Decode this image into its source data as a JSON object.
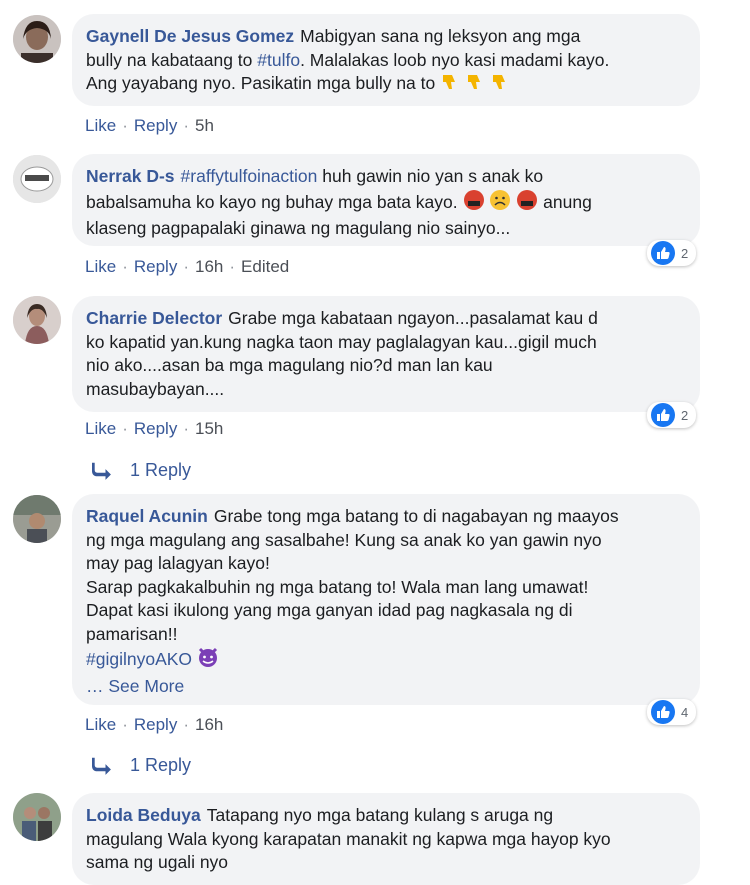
{
  "actions": {
    "like": "Like",
    "reply": "Reply",
    "separator": "·"
  },
  "colors": {
    "link": "#385898",
    "bubble": "#f2f3f5",
    "like_blue": "#1877f2"
  },
  "comments": [
    {
      "author": "Gaynell De Jesus Gomez",
      "lines": [
        [
          "Mabigyan sana ng leksyon ang mga"
        ],
        [
          "bully na kabataang to ",
          "#tulfo",
          ". Malalakas loob nyo kasi madami kayo."
        ],
        [
          "Ang yayabang nyo. Pasikatin mga bully na to"
        ]
      ],
      "emojis": [
        "thumbs-down-emoji",
        "thumbs-down-emoji",
        "thumbs-down-emoji"
      ],
      "time": "5h"
    },
    {
      "author": "Nerrak D-s",
      "lines": [
        [
          "#raffytulfoinaction",
          " huh gawin nio yan s anak ko"
        ],
        [
          "babalsamuha ko kayo ng buhay mga bata kayo."
        ],
        [
          "klaseng pagpapalaki ginawa ng magulang nio sainyo..."
        ]
      ],
      "line2_tail": "anung",
      "emojis": [
        "swearing-face-emoji",
        "frowning-face-emoji",
        "swearing-face-emoji"
      ],
      "time": "16h",
      "edited": "Edited",
      "reactions": "2"
    },
    {
      "author": "Charrie Delector",
      "lines": [
        [
          "Grabe mga kabataan ngayon...pasalamat kau d"
        ],
        [
          "ko kapatid yan.kung nagka taon may paglalagyan kau...gigil much"
        ],
        [
          "nio ako....asan ba mga magulang nio?d man lan kau"
        ],
        [
          "masubaybayan...."
        ]
      ],
      "time": "15h",
      "reactions": "2",
      "replies": "1 Reply"
    },
    {
      "author": "Raquel Acunin",
      "lines": [
        [
          "Grabe tong mga batang to di nagabayan ng maayos"
        ],
        [
          "ng mga magulang ang sasalbahe! Kung sa anak ko yan gawin nyo"
        ],
        [
          "may pag lalagyan kayo!"
        ],
        [
          "Sarap pagkakalbuhin ng mga batang to! Wala man lang umawat!"
        ],
        [
          "Dapat kasi ikulong yang mga ganyan idad pag nagkasala ng di"
        ],
        [
          "pamarisan!!"
        ]
      ],
      "hashtag": "#gigilnyoAKO",
      "emojis": [
        "devil-face-emoji"
      ],
      "see_more": "… See More",
      "time": "16h",
      "reactions": "4",
      "replies": "1 Reply"
    },
    {
      "author": "Loida Beduya",
      "lines": [
        [
          "Tatapang nyo mga batang kulang s aruga ng"
        ],
        [
          "magulang Wala kyong karapatan manakit ng kapwa mga hayop kyo"
        ],
        [
          "sama ng ugali nyo"
        ]
      ]
    }
  ]
}
